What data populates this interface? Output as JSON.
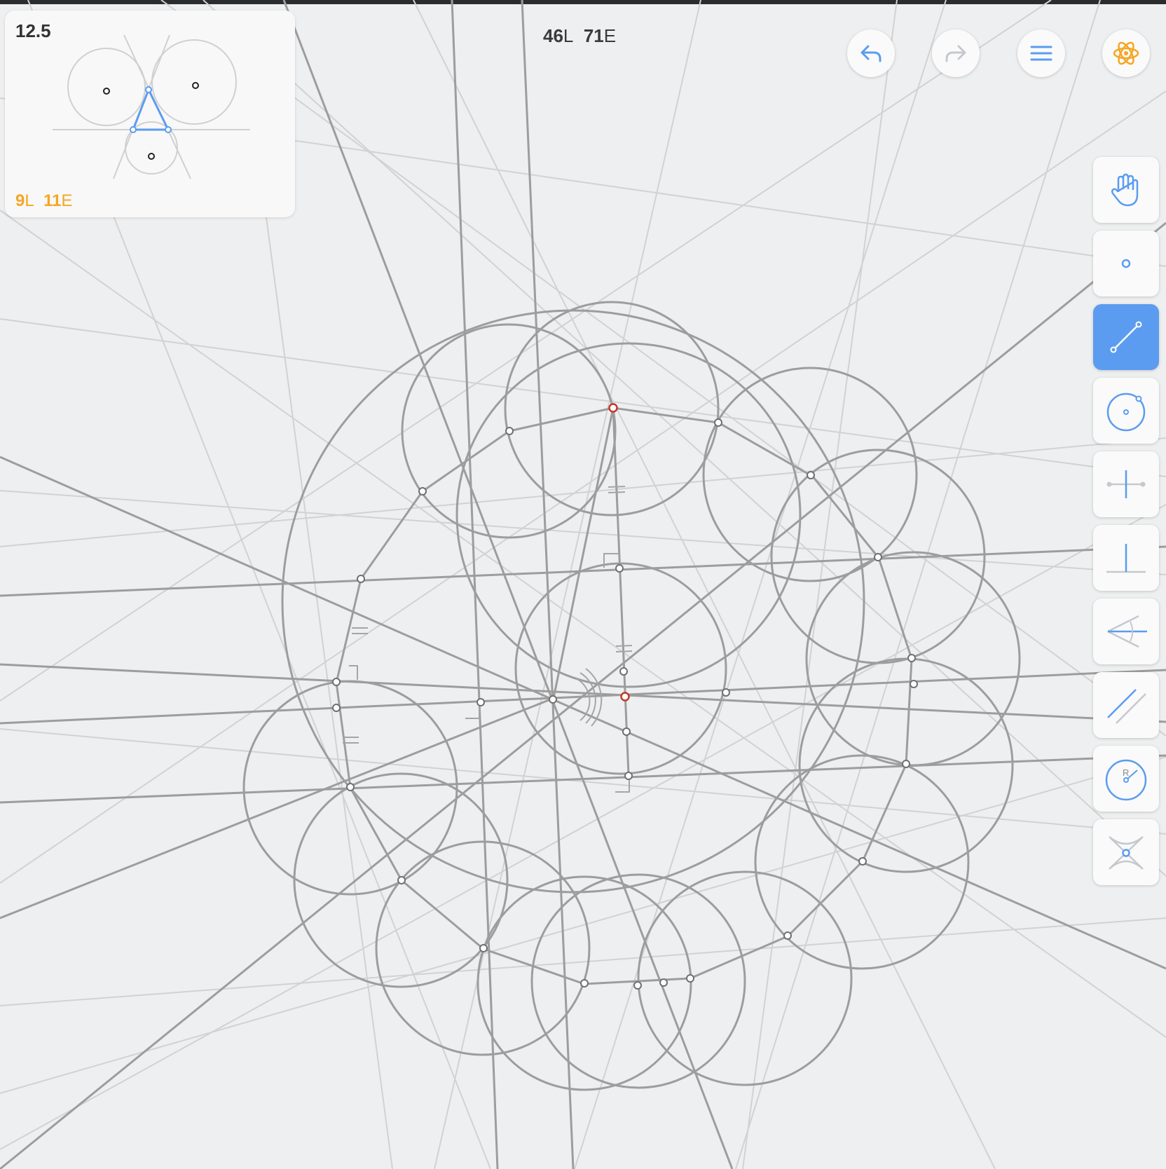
{
  "level_card": {
    "number": "12.5",
    "goal_lines": "9",
    "goal_lines_unit": "L",
    "goal_elementary": "11",
    "goal_elementary_unit": "E"
  },
  "move_counter": {
    "lines": "46",
    "lines_unit": "L",
    "elementary": "71",
    "elementary_unit": "E"
  },
  "header_buttons": [
    {
      "name": "undo",
      "icon": "undo-arrow-icon",
      "enabled": true
    },
    {
      "name": "redo",
      "icon": "redo-arrow-icon",
      "enabled": false
    },
    {
      "name": "menu",
      "icon": "hamburger-menu-icon",
      "enabled": true
    },
    {
      "name": "hint",
      "icon": "atom-icon",
      "enabled": true
    }
  ],
  "tools": [
    {
      "name": "move",
      "icon": "hand-icon",
      "active": false
    },
    {
      "name": "point",
      "icon": "point-icon",
      "active": false
    },
    {
      "name": "line",
      "icon": "line-icon",
      "active": true
    },
    {
      "name": "circle",
      "icon": "circle-icon",
      "active": false
    },
    {
      "name": "perpendicular-bisector",
      "icon": "perpendicular-bisector-icon",
      "active": false
    },
    {
      "name": "perpendicular",
      "icon": "perpendicular-icon",
      "active": false
    },
    {
      "name": "angle-bisector",
      "icon": "angle-bisector-icon",
      "active": false
    },
    {
      "name": "parallel",
      "icon": "parallel-lines-icon",
      "active": false
    },
    {
      "name": "compass",
      "icon": "compass-circle-icon",
      "active": false,
      "label": "R"
    },
    {
      "name": "intersect",
      "icon": "intersection-icon",
      "active": false
    }
  ],
  "colors": {
    "accent": "#5b9cf0",
    "goal": "#f5a623",
    "construction": "#9a9a9a",
    "faint": "#d2d2d2",
    "highlight_point": "#c0392b",
    "background": "#eeeff0"
  }
}
